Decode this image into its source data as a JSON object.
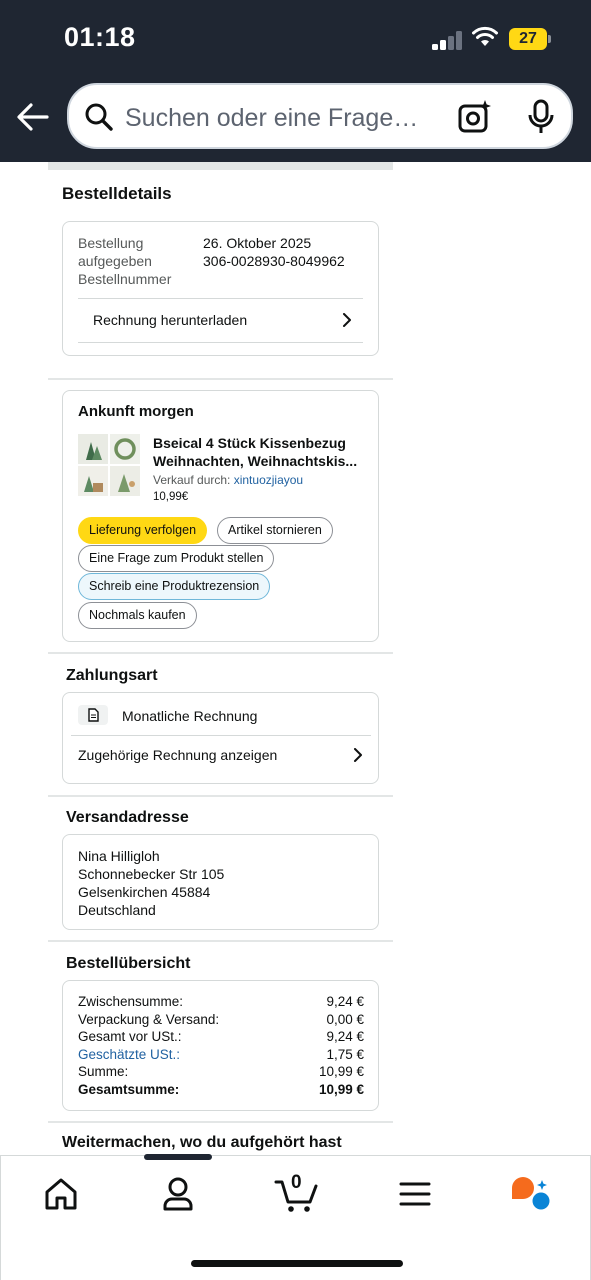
{
  "status": {
    "time": "01:18",
    "battery": "27"
  },
  "search": {
    "placeholder": "Suchen oder eine Frage…"
  },
  "order_details": {
    "heading": "Bestelldetails",
    "placed_label": "Bestellung aufgegeben",
    "placed_label_1": "Bestellung",
    "placed_label_2": "aufgegeben",
    "placed_value": "26. Oktober 2025",
    "number_label": "Bestellnummer",
    "number_value": "306-0028930-8049962",
    "invoice_link": "Rechnung herunterladen"
  },
  "shipment": {
    "title": "Ankunft morgen",
    "product_title": "Bseical 4 Stück Kissenbezug Weihnachten, Weihnachtskis...",
    "product_title_1": "Bseical 4 Stück Kissenbezug",
    "product_title_2": "Weihnachten, Weihnachtskis...",
    "seller_prefix": "Verkauf durch: ",
    "seller": "xintuozjiayou",
    "price": "10,99€",
    "actions": {
      "track": "Lieferung verfolgen",
      "cancel": "Artikel stornieren",
      "question": "Eine Frage zum Produkt stellen",
      "review": "Schreib eine Produktrezension",
      "buy_again": "Nochmals kaufen"
    }
  },
  "payment": {
    "heading": "Zahlungsart",
    "method": "Monatliche Rechnung",
    "invoice_link": "Zugehörige Rechnung anzeigen"
  },
  "shipping_address": {
    "heading": "Versandadresse",
    "name": "Nina Hilligloh",
    "street": "Schonnebecker Str 105",
    "city": "Gelsenkirchen 45884",
    "country": "Deutschland"
  },
  "summary": {
    "heading": "Bestellübersicht",
    "rows": [
      {
        "label": "Zwischensumme:",
        "value": "9,24 €"
      },
      {
        "label": "Verpackung & Versand:",
        "value": "0,00 €"
      },
      {
        "label": "Gesamt vor USt.:",
        "value": "9,24 €"
      },
      {
        "label": "Geschätzte USt.:",
        "value": "1,75 €"
      },
      {
        "label": "Summe:",
        "value": "10,99 €"
      },
      {
        "label": "Gesamtsumme:",
        "value": "10,99 €"
      }
    ]
  },
  "continue": {
    "heading": "Weitermachen, wo du aufgehört hast"
  },
  "tabbar": {
    "cart_count": "0"
  },
  "colors": {
    "header_bg": "#1f2632",
    "accent_yellow": "#ffd814",
    "link_blue": "#2162a1",
    "alexa_orange": "#f56b1d",
    "alexa_blue": "#0a84d6"
  }
}
